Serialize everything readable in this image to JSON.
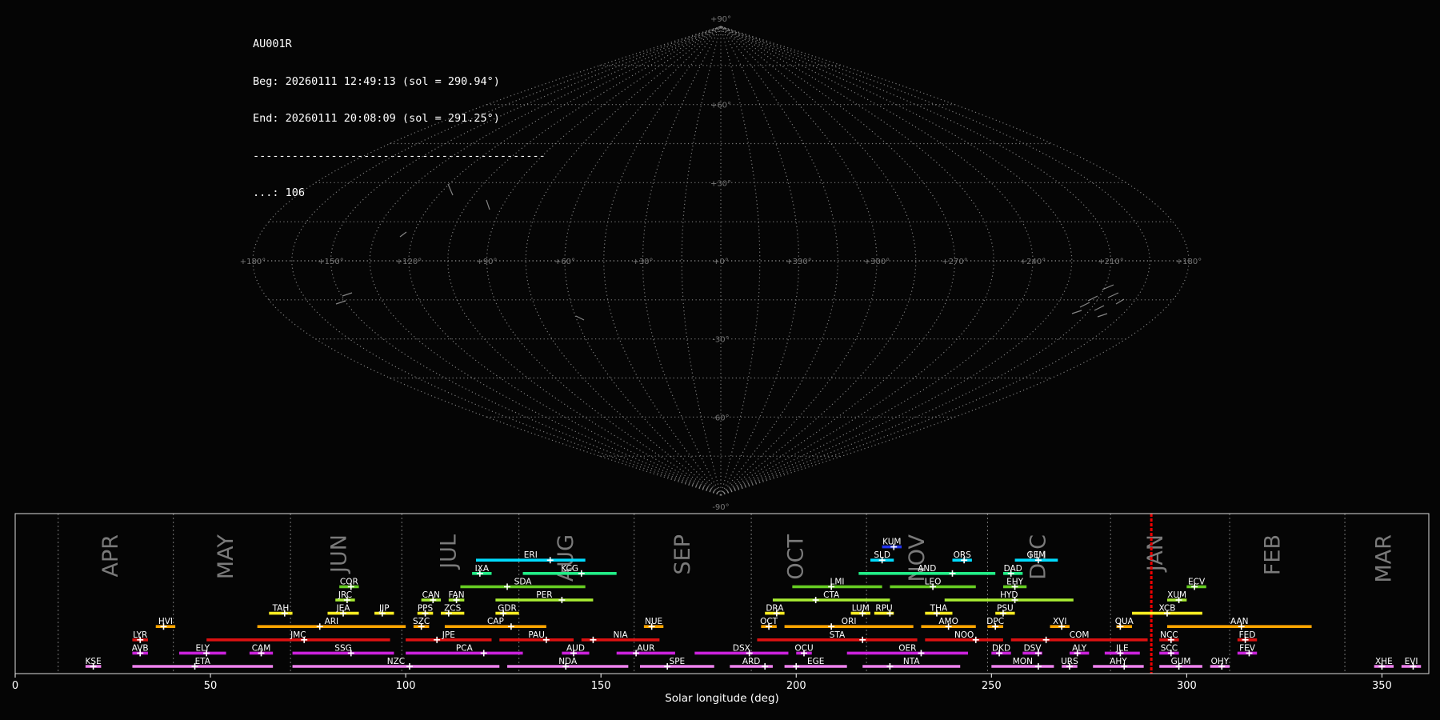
{
  "header": {
    "camera": "AU001R",
    "beg": "Beg: 20260111 12:49:13 (sol = 290.94°)",
    "end": "End: 20260111 20:08:09 (sol = 291.25°)",
    "separator": "---------------------------------------------",
    "count": "...: 106"
  },
  "sky_map": {
    "projection": "sinusoidal",
    "lat_labels": [
      "+90°",
      "+60°",
      "+30°",
      "-30°",
      "-60°",
      "-90°"
    ],
    "lon_labels": [
      "+180°",
      "+150°",
      "+120°",
      "+90°",
      "+60°",
      "+30°",
      "+0°",
      "+330°",
      "+300°",
      "+270°",
      "+240°",
      "+210°",
      "+180°"
    ]
  },
  "chart_data": {
    "type": "gantt",
    "xlabel": "Solar longitude (deg)",
    "xlim": [
      0,
      362
    ],
    "xticks": [
      0,
      50,
      100,
      150,
      200,
      250,
      300,
      350
    ],
    "month_lines": [
      11,
      40.5,
      70.5,
      99,
      129,
      158.5,
      188.5,
      218,
      249,
      280.5,
      311,
      340.5
    ],
    "months": [
      {
        "label": "APR",
        "sol": 24.5
      },
      {
        "label": "MAY",
        "sol": 54
      },
      {
        "label": "JUN",
        "sol": 83
      },
      {
        "label": "JUL",
        "sol": 111
      },
      {
        "label": "AUG",
        "sol": 141
      },
      {
        "label": "SEP",
        "sol": 171
      },
      {
        "label": "OCT",
        "sol": 200
      },
      {
        "label": "NOV",
        "sol": 231
      },
      {
        "label": "DEC",
        "sol": 262
      },
      {
        "label": "JAN",
        "sol": 292
      },
      {
        "label": "FEB",
        "sol": 322
      },
      {
        "label": "MAR",
        "sol": 350.5
      }
    ],
    "current_sol": 290.94,
    "colors": {
      "r0": "#ee82ee",
      "r1": "#cc22dd",
      "r2": "#dd1111",
      "r3": "#ffa500",
      "r4": "#ffee22",
      "r5": "#aaee33",
      "r6": "#66cc22",
      "r7": "#22ee88",
      "r8": "#00ddff",
      "r9": "#2233ee"
    },
    "showers": [
      {
        "code": "KSE",
        "start": 18,
        "end": 22,
        "peak": 20,
        "row": 0,
        "color": "r0"
      },
      {
        "code": "ETA",
        "start": 30,
        "end": 66,
        "peak": 46,
        "row": 0,
        "color": "r0"
      },
      {
        "code": "NZC",
        "start": 71,
        "end": 124,
        "peak": 101,
        "row": 0,
        "color": "r0"
      },
      {
        "code": "NDA",
        "start": 126,
        "end": 157,
        "peak": 141,
        "row": 0,
        "color": "r0"
      },
      {
        "code": "SPE",
        "start": 160,
        "end": 179,
        "peak": 167,
        "row": 0,
        "color": "r0"
      },
      {
        "code": "ARD",
        "start": 183,
        "end": 194,
        "peak": 192,
        "row": 0,
        "color": "r0"
      },
      {
        "code": "EGE",
        "start": 197,
        "end": 213,
        "peak": 200,
        "row": 0,
        "color": "r0"
      },
      {
        "code": "NTA",
        "start": 217,
        "end": 242,
        "peak": 224,
        "row": 0,
        "color": "r0"
      },
      {
        "code": "MON",
        "start": 250,
        "end": 266,
        "peak": 262,
        "row": 0,
        "color": "r0"
      },
      {
        "code": "URS",
        "start": 268,
        "end": 272,
        "peak": 270,
        "row": 0,
        "color": "r0"
      },
      {
        "code": "AHY",
        "start": 276,
        "end": 289,
        "peak": 284,
        "row": 0,
        "color": "r0"
      },
      {
        "code": "GUM",
        "start": 293,
        "end": 304,
        "peak": 298,
        "row": 0,
        "color": "r0"
      },
      {
        "code": "OHY",
        "start": 306,
        "end": 311,
        "peak": 309,
        "row": 0,
        "color": "r0"
      },
      {
        "code": "XHE",
        "start": 348,
        "end": 353,
        "peak": 350,
        "row": 0,
        "color": "r0"
      },
      {
        "code": "EVI",
        "start": 355,
        "end": 360,
        "peak": 358,
        "row": 0,
        "color": "r0"
      },
      {
        "code": "AVB",
        "start": 30,
        "end": 34,
        "peak": 32,
        "row": 1,
        "color": "r1"
      },
      {
        "code": "ELY",
        "start": 42,
        "end": 54,
        "peak": 49,
        "row": 1,
        "color": "r1"
      },
      {
        "code": "CAM",
        "start": 60,
        "end": 66,
        "peak": 63,
        "row": 1,
        "color": "r1"
      },
      {
        "code": "SSG",
        "start": 71,
        "end": 97,
        "peak": 86,
        "row": 1,
        "color": "r1"
      },
      {
        "code": "PCA",
        "start": 100,
        "end": 130,
        "peak": 120,
        "row": 1,
        "color": "r1"
      },
      {
        "code": "AUD",
        "start": 140,
        "end": 147,
        "peak": 143,
        "row": 1,
        "color": "r1"
      },
      {
        "code": "AUR",
        "start": 154,
        "end": 169,
        "peak": 159,
        "row": 1,
        "color": "r1"
      },
      {
        "code": "DSX",
        "start": 174,
        "end": 198,
        "peak": 188,
        "row": 1,
        "color": "r1"
      },
      {
        "code": "OCU",
        "start": 200,
        "end": 204,
        "peak": 202,
        "row": 1,
        "color": "r1"
      },
      {
        "code": "OER",
        "start": 213,
        "end": 244,
        "peak": 232,
        "row": 1,
        "color": "r1"
      },
      {
        "code": "DKD",
        "start": 250,
        "end": 255,
        "peak": 252,
        "row": 1,
        "color": "r1"
      },
      {
        "code": "DSV",
        "start": 258,
        "end": 263,
        "peak": 262,
        "row": 1,
        "color": "r1"
      },
      {
        "code": "ALY",
        "start": 270,
        "end": 275,
        "peak": 272,
        "row": 1,
        "color": "r1"
      },
      {
        "code": "JLE",
        "start": 279,
        "end": 288,
        "peak": 283,
        "row": 1,
        "color": "r1"
      },
      {
        "code": "SCC",
        "start": 293,
        "end": 298,
        "peak": 296,
        "row": 1,
        "color": "r1"
      },
      {
        "code": "FEV",
        "start": 313,
        "end": 318,
        "peak": 316,
        "row": 1,
        "color": "r1"
      },
      {
        "code": "LYR",
        "start": 30,
        "end": 34,
        "peak": 32,
        "row": 2,
        "color": "r2"
      },
      {
        "code": "JMC",
        "start": 49,
        "end": 96,
        "peak": 74,
        "row": 2,
        "color": "r2"
      },
      {
        "code": "JPE",
        "start": 100,
        "end": 122,
        "peak": 108,
        "row": 2,
        "color": "r2"
      },
      {
        "code": "PAU",
        "start": 124,
        "end": 143,
        "peak": 136,
        "row": 2,
        "color": "r2"
      },
      {
        "code": "NIA",
        "start": 145,
        "end": 165,
        "peak": 148,
        "row": 2,
        "color": "r2"
      },
      {
        "code": "STA",
        "start": 190,
        "end": 231,
        "peak": 217,
        "row": 2,
        "color": "r2"
      },
      {
        "code": "NOO",
        "start": 233,
        "end": 253,
        "peak": 246,
        "row": 2,
        "color": "r2"
      },
      {
        "code": "COM",
        "start": 255,
        "end": 290,
        "peak": 264,
        "row": 2,
        "color": "r2"
      },
      {
        "code": "NCC",
        "start": 293,
        "end": 298,
        "peak": 296,
        "row": 2,
        "color": "r2"
      },
      {
        "code": "FED",
        "start": 313,
        "end": 318,
        "peak": 315,
        "row": 2,
        "color": "r2"
      },
      {
        "code": "HVI",
        "start": 36,
        "end": 41,
        "peak": 38,
        "row": 3,
        "color": "r3"
      },
      {
        "code": "ARI",
        "start": 62,
        "end": 100,
        "peak": 78,
        "row": 3,
        "color": "r3"
      },
      {
        "code": "SZC",
        "start": 102,
        "end": 106,
        "peak": 104,
        "row": 3,
        "color": "r3"
      },
      {
        "code": "CAP",
        "start": 110,
        "end": 136,
        "peak": 127,
        "row": 3,
        "color": "r3"
      },
      {
        "code": "NUE",
        "start": 161,
        "end": 166,
        "peak": 163,
        "row": 3,
        "color": "r3"
      },
      {
        "code": "OCT",
        "start": 191,
        "end": 195,
        "peak": 193,
        "row": 3,
        "color": "r3"
      },
      {
        "code": "ORI",
        "start": 197,
        "end": 230,
        "peak": 209,
        "row": 3,
        "color": "r3"
      },
      {
        "code": "AMO",
        "start": 232,
        "end": 246,
        "peak": 239,
        "row": 3,
        "color": "r3"
      },
      {
        "code": "DPC",
        "start": 249,
        "end": 253,
        "peak": 251,
        "row": 3,
        "color": "r3"
      },
      {
        "code": "XVI",
        "start": 265,
        "end": 270,
        "peak": 268,
        "row": 3,
        "color": "r3"
      },
      {
        "code": "QUA",
        "start": 282,
        "end": 286,
        "peak": 283,
        "row": 3,
        "color": "r3"
      },
      {
        "code": "AAN",
        "start": 295,
        "end": 332,
        "peak": 314,
        "row": 3,
        "color": "r3"
      },
      {
        "code": "TAH",
        "start": 65,
        "end": 71,
        "peak": 69,
        "row": 4,
        "color": "r4"
      },
      {
        "code": "JEA",
        "start": 80,
        "end": 88,
        "peak": 84,
        "row": 4,
        "color": "r4"
      },
      {
        "code": "JIP",
        "start": 92,
        "end": 97,
        "peak": 94,
        "row": 4,
        "color": "r4"
      },
      {
        "code": "PPS",
        "start": 103,
        "end": 107,
        "peak": 105,
        "row": 4,
        "color": "r4"
      },
      {
        "code": "ZCS",
        "start": 109,
        "end": 115,
        "peak": 111,
        "row": 4,
        "color": "r4"
      },
      {
        "code": "GDR",
        "start": 123,
        "end": 129,
        "peak": 125,
        "row": 4,
        "color": "r4"
      },
      {
        "code": "DRA",
        "start": 192,
        "end": 197,
        "peak": 195,
        "row": 4,
        "color": "r4"
      },
      {
        "code": "LUM",
        "start": 214,
        "end": 219,
        "peak": 217,
        "row": 4,
        "color": "r4"
      },
      {
        "code": "RPU",
        "start": 220,
        "end": 225,
        "peak": 224,
        "row": 4,
        "color": "r4"
      },
      {
        "code": "THA",
        "start": 233,
        "end": 240,
        "peak": 236,
        "row": 4,
        "color": "r4"
      },
      {
        "code": "PSU",
        "start": 251,
        "end": 256,
        "peak": 253,
        "row": 4,
        "color": "r4"
      },
      {
        "code": "XCB",
        "start": 286,
        "end": 304,
        "peak": 295,
        "row": 4,
        "color": "r4"
      },
      {
        "code": "JRC",
        "start": 82,
        "end": 87,
        "peak": 85,
        "row": 5,
        "color": "r5"
      },
      {
        "code": "CAN",
        "start": 104,
        "end": 109,
        "peak": 107,
        "row": 5,
        "color": "r5"
      },
      {
        "code": "FAN",
        "start": 111,
        "end": 115,
        "peak": 113,
        "row": 5,
        "color": "r5"
      },
      {
        "code": "PER",
        "start": 123,
        "end": 148,
        "peak": 140,
        "row": 5,
        "color": "r5"
      },
      {
        "code": "CTA",
        "start": 194,
        "end": 224,
        "peak": 205,
        "row": 5,
        "color": "r5"
      },
      {
        "code": "HYD",
        "start": 238,
        "end": 271,
        "peak": 256,
        "row": 5,
        "color": "r5"
      },
      {
        "code": "XUM",
        "start": 295,
        "end": 300,
        "peak": 298,
        "row": 5,
        "color": "r5"
      },
      {
        "code": "COR",
        "start": 83,
        "end": 88,
        "peak": 86,
        "row": 6,
        "color": "r6"
      },
      {
        "code": "SDA",
        "start": 114,
        "end": 146,
        "peak": 126,
        "row": 6,
        "color": "r6"
      },
      {
        "code": "LMI",
        "start": 199,
        "end": 222,
        "peak": 209,
        "row": 6,
        "color": "r6"
      },
      {
        "code": "LEO",
        "start": 224,
        "end": 246,
        "peak": 235,
        "row": 6,
        "color": "r6"
      },
      {
        "code": "EHY",
        "start": 253,
        "end": 259,
        "peak": 256,
        "row": 6,
        "color": "r6"
      },
      {
        "code": "ECV",
        "start": 300,
        "end": 305,
        "peak": 302,
        "row": 6,
        "color": "r6"
      },
      {
        "code": "IXA",
        "start": 117,
        "end": 122,
        "peak": 119,
        "row": 7,
        "color": "r7"
      },
      {
        "code": "KCG",
        "start": 130,
        "end": 154,
        "peak": 145,
        "row": 7,
        "color": "r7"
      },
      {
        "code": "AND",
        "start": 216,
        "end": 251,
        "peak": 240,
        "row": 7,
        "color": "r7"
      },
      {
        "code": "DAD",
        "start": 253,
        "end": 258,
        "peak": 255,
        "row": 7,
        "color": "r7"
      },
      {
        "code": "ERI",
        "start": 118,
        "end": 146,
        "peak": 137,
        "row": 8,
        "color": "r8"
      },
      {
        "code": "SLD",
        "start": 219,
        "end": 225,
        "peak": 222,
        "row": 8,
        "color": "r8"
      },
      {
        "code": "ORS",
        "start": 240,
        "end": 245,
        "peak": 243,
        "row": 8,
        "color": "r8"
      },
      {
        "code": "GEM",
        "start": 256,
        "end": 267,
        "peak": 262,
        "row": 8,
        "color": "r8"
      },
      {
        "code": "KUM",
        "start": 222,
        "end": 227,
        "peak": 225,
        "row": 9,
        "color": "r9"
      }
    ]
  }
}
